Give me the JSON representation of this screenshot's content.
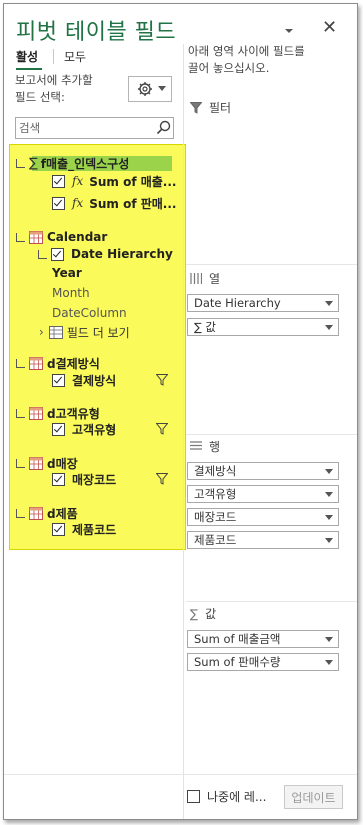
{
  "header": {
    "title": "피벗 테이블 필드"
  },
  "tabs": [
    {
      "label": "활성"
    },
    {
      "label": "모두"
    }
  ],
  "field_pick": {
    "label_line1": "보고서에 추가할",
    "label_line2": "필드 선택:"
  },
  "search": {
    "placeholder": "검색"
  },
  "tree": {
    "measures_table": "f매출_인덱스구성",
    "measure1": "Sum of 매출...",
    "measure2": "Sum of 판매...",
    "calendar": "Calendar",
    "date_hierarchy_line1": "Date Hierarchy",
    "date_hierarchy_line2": "Year",
    "month": "Month",
    "date_column": "DateColumn",
    "more_fields": "필드 더 보기",
    "t_pay": "d결제방식",
    "f_pay": "결제방식",
    "t_cust": "d고객유형",
    "f_cust": "고객유형",
    "t_store": "d매장",
    "f_store": "매장코드",
    "t_prod": "d제품",
    "f_prod": "제품코드",
    "fx_symbol": "fx",
    "sigma": "∑"
  },
  "right_panel": {
    "instructions_line1": "아래 영역 사이에 필드를",
    "instructions_line2": "끌어 놓으십시오.",
    "filters_label": "필터",
    "columns_label": "열",
    "columns_items": [
      "Date Hierarchy",
      "∑ 값"
    ],
    "rows_label": "행",
    "rows_items": [
      "결제방식",
      "고객유형",
      "매장코드",
      "제품코드"
    ],
    "values_label": "값",
    "values_items": [
      "Sum of 매출금액",
      "Sum of 판매수량"
    ]
  },
  "footer": {
    "defer_label": "나중에 레...",
    "update_label": "업데이트"
  },
  "colors": {
    "accent": "#217346",
    "highlight": "#fafa5a",
    "selected_row": "#9bd34a"
  }
}
